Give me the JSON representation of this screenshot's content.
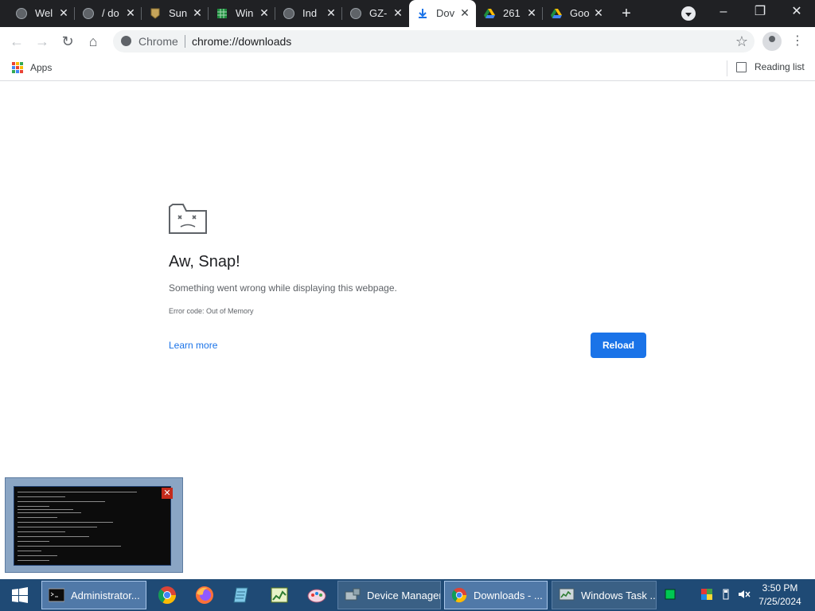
{
  "tabs": [
    {
      "title": "Wel",
      "favicon": "globe-icon"
    },
    {
      "title": "/ do",
      "favicon": "globe-icon"
    },
    {
      "title": "Sun",
      "favicon": "shield-icon"
    },
    {
      "title": "Win",
      "favicon": "spreadsheet-icon"
    },
    {
      "title": "Ind",
      "favicon": "globe-icon"
    },
    {
      "title": "GZ-",
      "favicon": "globe-icon"
    },
    {
      "title": "Dov",
      "favicon": "download-icon",
      "active": true
    },
    {
      "title": "261",
      "favicon": "google-drive-icon"
    },
    {
      "title": "Goo",
      "favicon": "google-drive-icon"
    }
  ],
  "omnibox": {
    "scheme": "Chrome",
    "url": "chrome://downloads"
  },
  "bookmarks": {
    "apps": "Apps",
    "reading_list": "Reading list"
  },
  "error": {
    "title": "Aw, Snap!",
    "message": "Something went wrong while displaying this webpage.",
    "code": "Error code: Out of Memory",
    "learn_more": "Learn more",
    "reload": "Reload"
  },
  "taskbar": {
    "windows": [
      {
        "label": "Administrator...",
        "icon": "cmd-icon",
        "active": true
      },
      {
        "label": "Device Manager",
        "icon": "device-manager-icon"
      },
      {
        "label": "Downloads - ...",
        "icon": "chrome-icon"
      },
      {
        "label": "Windows Task ...",
        "icon": "task-manager-icon"
      }
    ],
    "clock_time": "3:50 PM",
    "clock_date": "7/25/2024"
  },
  "colors": {
    "accent": "#1a73e8",
    "tabstrip": "#202124",
    "taskbar": "#1f4a75"
  }
}
